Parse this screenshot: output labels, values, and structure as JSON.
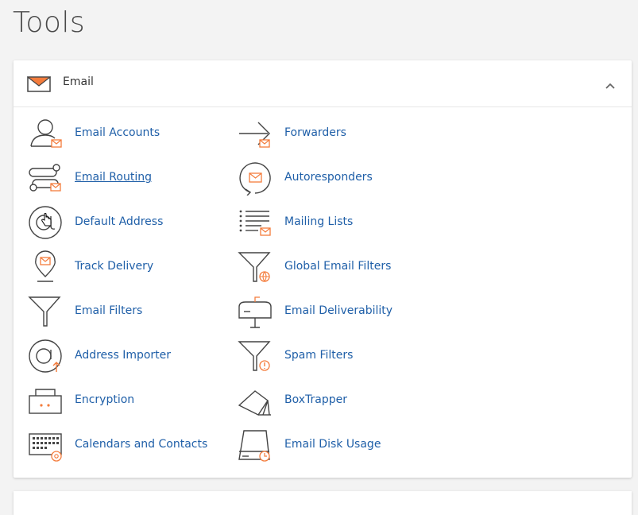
{
  "page": {
    "title": "Tools"
  },
  "section": {
    "label": "Email",
    "accent_color": "#f47c3c",
    "link_color": "#1f5fa8",
    "icon": "envelope-icon",
    "collapse_icon": "chevron-up-icon"
  },
  "tools": [
    {
      "label": "Email Accounts",
      "icon": "email-accounts-icon"
    },
    {
      "label": "Forwarders",
      "icon": "forwarders-icon"
    },
    {
      "label": "Email Routing",
      "icon": "email-routing-icon"
    },
    {
      "label": "Autoresponders",
      "icon": "autoresponders-icon"
    },
    {
      "label": "Default Address",
      "icon": "default-address-icon"
    },
    {
      "label": "Mailing Lists",
      "icon": "mailing-lists-icon"
    },
    {
      "label": "Track Delivery",
      "icon": "track-delivery-icon"
    },
    {
      "label": "Global Email Filters",
      "icon": "global-email-filters-icon"
    },
    {
      "label": "Email Filters",
      "icon": "email-filters-icon"
    },
    {
      "label": "Email Deliverability",
      "icon": "email-deliverability-icon"
    },
    {
      "label": "Address Importer",
      "icon": "address-importer-icon"
    },
    {
      "label": "Spam Filters",
      "icon": "spam-filters-icon"
    },
    {
      "label": "Encryption",
      "icon": "encryption-icon"
    },
    {
      "label": "BoxTrapper",
      "icon": "boxtrapper-icon"
    },
    {
      "label": "Calendars and Contacts",
      "icon": "calendars-contacts-icon"
    },
    {
      "label": "Email Disk Usage",
      "icon": "email-disk-usage-icon"
    }
  ]
}
